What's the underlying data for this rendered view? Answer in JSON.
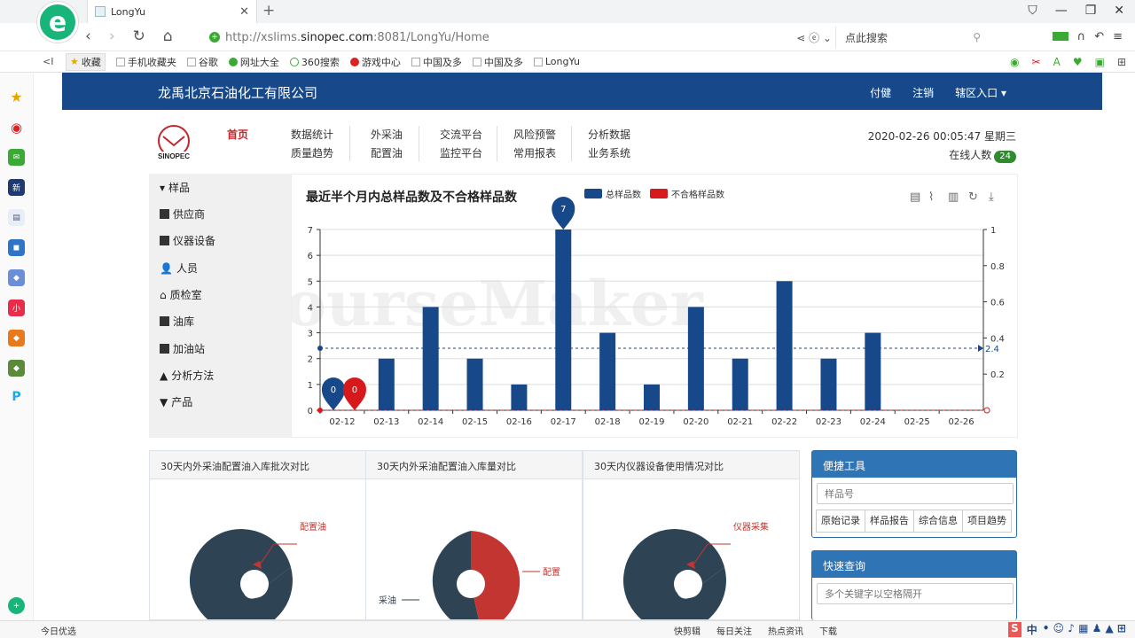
{
  "browser": {
    "tab_title": "LongYu",
    "url_prefix": "http://xslims.",
    "url_domain": "sinopec.com",
    "url_rest": ":8081/LongYu/Home",
    "search_placeholder": "点此搜索",
    "bookmarks": [
      "收藏",
      "手机收藏夹",
      "谷歌",
      "网址大全",
      "360搜索",
      "游戏中心",
      "中国及多",
      "中国及多",
      "LongYu"
    ],
    "status_left": "今日优选",
    "status_items": [
      "快剪辑",
      "每日关注",
      "热点资讯",
      "下载"
    ],
    "ime": "中"
  },
  "header": {
    "company": "龙禹北京石油化工有限公司",
    "links": [
      "付健",
      "注销",
      "辖区入口 ▾"
    ]
  },
  "topnav": {
    "home": "首页",
    "cols": [
      [
        "数据统计",
        "质量趋势"
      ],
      [
        "外采油",
        "配置油"
      ],
      [
        "交流平台",
        "监控平台"
      ],
      [
        "风险预警",
        "常用报表"
      ],
      [
        "分析数据",
        "业务系统"
      ]
    ]
  },
  "datetime": "2020-02-26 00:05:47 星期三",
  "online_label": "在线人数",
  "online_count": "24",
  "sidemenu": [
    "样品",
    "供应商",
    "仪器设备",
    "人员",
    "质检室",
    "油库",
    "加油站",
    "分析方法",
    "产品"
  ],
  "chart_data": {
    "type": "bar",
    "title": "最近半个月内总样品数及不合格样品数",
    "categories": [
      "02-12",
      "02-13",
      "02-14",
      "02-15",
      "02-16",
      "02-17",
      "02-18",
      "02-19",
      "02-20",
      "02-21",
      "02-22",
      "02-23",
      "02-24",
      "02-25",
      "02-26"
    ],
    "series": [
      {
        "name": "总样品数",
        "values": [
          0,
          2,
          4,
          2,
          1,
          7,
          3,
          1,
          4,
          2,
          5,
          2,
          3,
          0,
          0
        ],
        "color": "#17498a"
      },
      {
        "name": "不合格样品数",
        "values": [
          0,
          0,
          0,
          0,
          0,
          0,
          0,
          0,
          0,
          0,
          0,
          0,
          0,
          0,
          0
        ],
        "color": "#d7191c"
      }
    ],
    "ylim": [
      0,
      7
    ],
    "y2lim": [
      0,
      1
    ],
    "yticks": [
      "0",
      "1",
      "2",
      "3",
      "4",
      "5",
      "6",
      "7"
    ],
    "y2ticks": [
      "0.2",
      "0.4",
      "0.6",
      "0.8",
      "1"
    ],
    "markline_value": "2.4",
    "markpoints": [
      "7",
      "0",
      "0"
    ],
    "legend_position": "top-center"
  },
  "panels": [
    {
      "title": "30天内外采油配置油入库批次对比",
      "label": "配置油"
    },
    {
      "title": "30天内外采油配置油入库量对比",
      "label": "配置",
      "label2": "采油"
    },
    {
      "title": "30天内仪器设备使用情况对比",
      "label": "仪器采集"
    }
  ],
  "tools": {
    "title": "便捷工具",
    "placeholder": "样品号",
    "buttons": [
      "原始记录",
      "样品报告",
      "综合信息",
      "项目趋势"
    ]
  },
  "query": {
    "title": "快速查询",
    "placeholder": "多个关键字以空格隔开"
  },
  "watermark": "CourseMaker"
}
